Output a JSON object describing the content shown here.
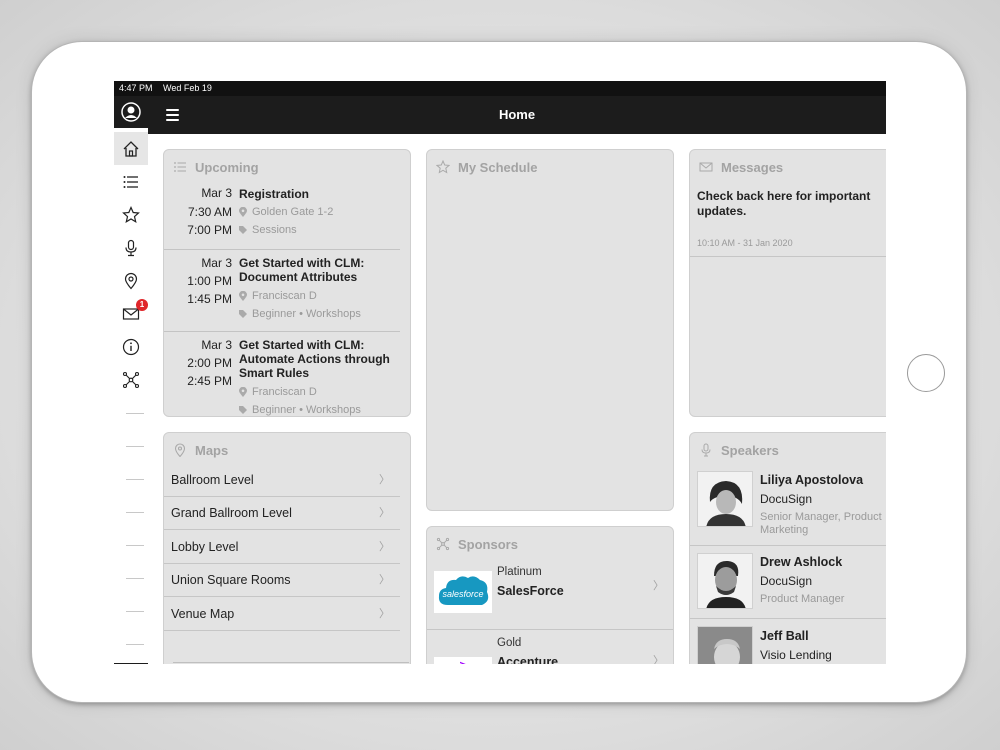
{
  "status": {
    "time": "4:47 PM",
    "date": "Wed Feb 19"
  },
  "navbar": {
    "title": "Home"
  },
  "rail": {
    "messages_badge": "1"
  },
  "upcoming": {
    "title": "Upcoming",
    "items": [
      {
        "date": "Mar 3",
        "start": "7:30 AM",
        "end": "7:00 PM",
        "title": "Registration",
        "location": "Golden Gate 1-2",
        "tags": "Sessions"
      },
      {
        "date": "Mar 3",
        "start": "1:00 PM",
        "end": "1:45 PM",
        "title": "Get Started with CLM: Document Attributes",
        "location": "Franciscan D",
        "tags": "Beginner • Workshops"
      },
      {
        "date": "Mar 3",
        "start": "2:00 PM",
        "end": "2:45 PM",
        "title": "Get Started with CLM: Automate Actions through Smart Rules",
        "location": "Franciscan D",
        "tags": "Beginner • Workshops"
      }
    ]
  },
  "schedule": {
    "title": "My Schedule"
  },
  "messages": {
    "title": "Messages",
    "text": "Check back here for important updates.",
    "time": "10:10 AM - 31 Jan 2020"
  },
  "maps": {
    "title": "Maps",
    "items": [
      "Ballroom Level",
      "Grand Ballroom Level",
      "Lobby Level",
      "Union Square Rooms",
      "Venue Map"
    ]
  },
  "sponsors": {
    "title": "Sponsors",
    "items": [
      {
        "tier": "Platinum",
        "name": "SalesForce",
        "logo_text": "salesforce"
      },
      {
        "tier": "Gold",
        "name": "Accenture",
        "logo_text": ">"
      }
    ]
  },
  "speakers": {
    "title": "Speakers",
    "items": [
      {
        "name": "Liliya Apostolova",
        "org": "DocuSign",
        "title": "Senior Manager, Product Marketing"
      },
      {
        "name": "Drew Ashlock",
        "org": "DocuSign",
        "title": "Product Manager"
      },
      {
        "name": "Jeff Ball",
        "org": "Visio Lending",
        "title": ""
      }
    ]
  },
  "colors": {
    "brand_dark": "#1c1c1c",
    "badge_red": "#e0262a",
    "salesforce_blue": "#1798c1",
    "accenture_purple": "#a100ff"
  }
}
